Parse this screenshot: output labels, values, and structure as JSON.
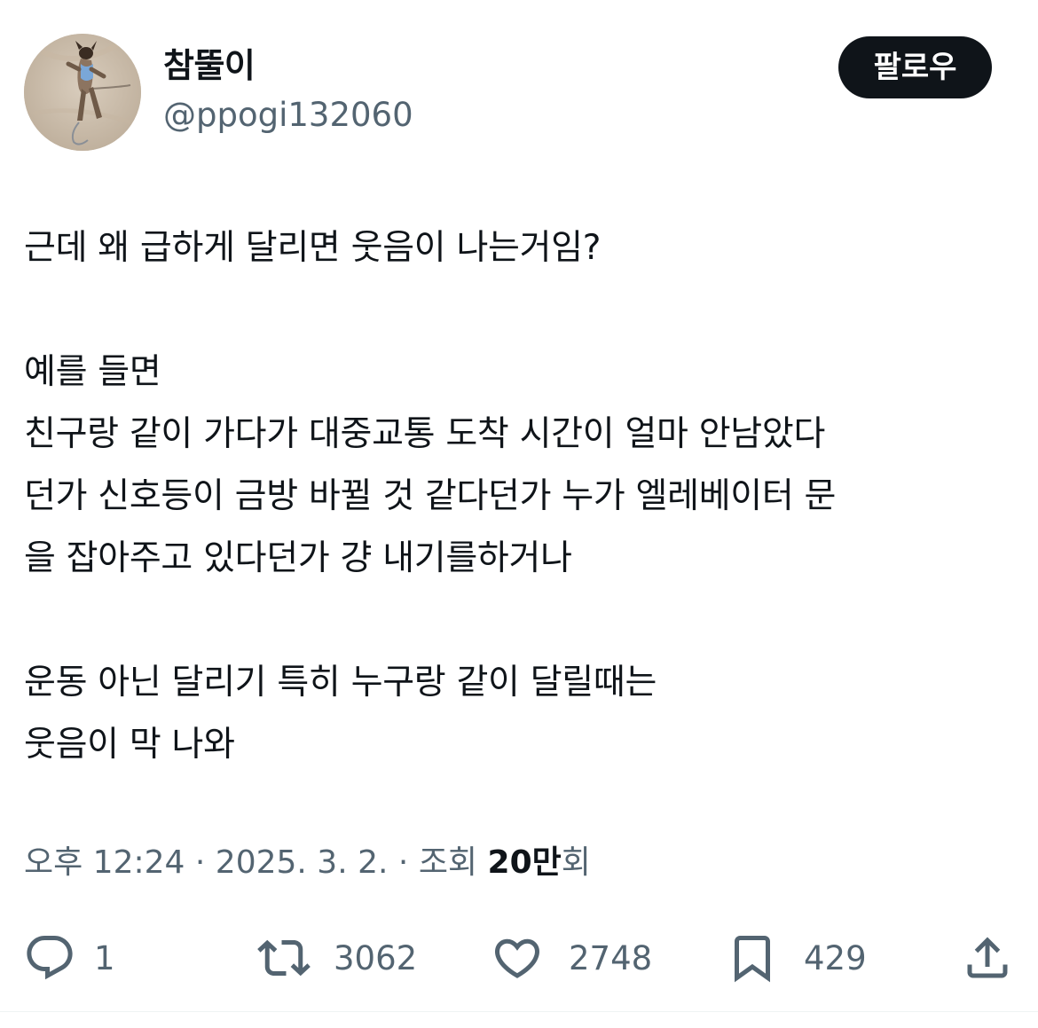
{
  "author": {
    "display_name": "참뚤이",
    "handle": "@ppogi132060"
  },
  "follow_button": {
    "label": "팔로우"
  },
  "tweet": {
    "lines": [
      "근데 왜 급하게 달리면 웃음이 나는거임?",
      "",
      "예를 들면",
      "친구랑 같이 가다가 대중교통 도착 시간이 얼마 안남았다",
      "던가 신호등이 금방 바뀔 것 같다던가 누가 엘레베이터 문",
      "을 잡아주고 있다던가 걍 내기를하거나",
      "",
      "운동 아닌 달리기 특히 누구랑 같이 달릴때는",
      "웃음이 막 나와"
    ]
  },
  "meta": {
    "time": "오후 12:24",
    "separator": "·",
    "date": "2025. 3. 2.",
    "views_label": "조회",
    "views_count": "20만",
    "views_suffix": "회"
  },
  "actions": {
    "reply": {
      "icon": "reply-icon",
      "count": "1"
    },
    "retweet": {
      "icon": "retweet-icon",
      "count": "3062"
    },
    "like": {
      "icon": "heart-icon",
      "count": "2748"
    },
    "bookmark": {
      "icon": "bookmark-icon",
      "count": "429"
    },
    "share": {
      "icon": "share-icon"
    }
  },
  "colors": {
    "text_primary": "#0f1419",
    "text_secondary": "#536471",
    "button_bg": "#0f1419",
    "button_text": "#ffffff",
    "divider": "#eff3f4"
  }
}
